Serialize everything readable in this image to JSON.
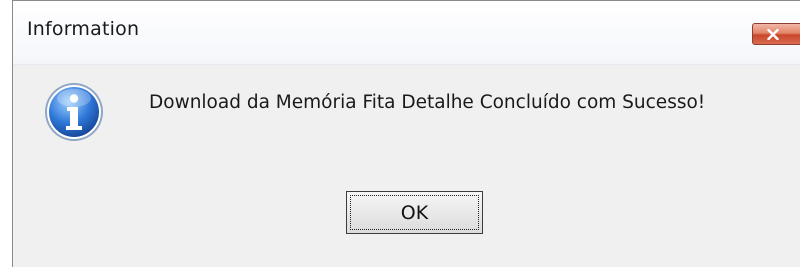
{
  "dialog": {
    "title": "Information",
    "message": "Download da Memória Fita Detalhe Concluído com Sucesso!",
    "ok_label": "OK",
    "icon": "info-icon",
    "close_icon": "close-icon"
  },
  "colors": {
    "content_background": "#f0f0f0",
    "close_button": "#d86b4f",
    "info_icon": "#1f5fbf"
  }
}
